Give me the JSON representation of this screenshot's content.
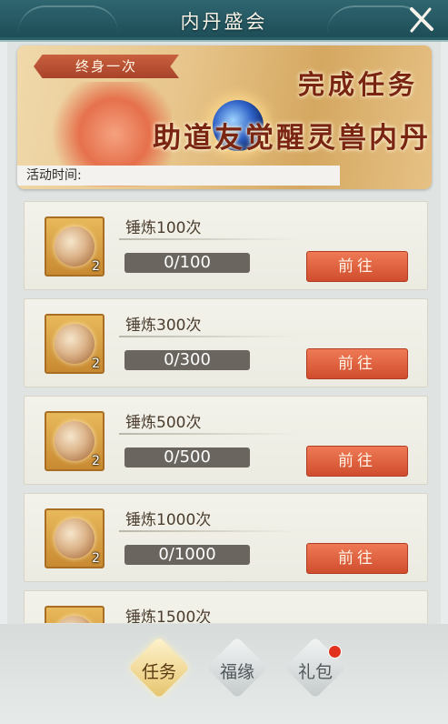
{
  "window": {
    "title": "内丹盛会"
  },
  "banner": {
    "badge": "终身一次",
    "headline": "完成任务",
    "subline": "助道友觉醒灵兽内丹",
    "time_label": "活动时间:"
  },
  "tasks": [
    {
      "name": "锤炼100次",
      "progress": "0/100",
      "reward_qty": "2",
      "button": "前往"
    },
    {
      "name": "锤炼300次",
      "progress": "0/300",
      "reward_qty": "2",
      "button": "前往"
    },
    {
      "name": "锤炼500次",
      "progress": "0/500",
      "reward_qty": "2",
      "button": "前往"
    },
    {
      "name": "锤炼1000次",
      "progress": "0/1000",
      "reward_qty": "2",
      "button": "前往"
    },
    {
      "name": "锤炼1500次",
      "progress": "",
      "reward_qty": "",
      "button": ""
    }
  ],
  "tabs": [
    {
      "label": "任务",
      "active": true
    },
    {
      "label": "福缘",
      "active": false
    },
    {
      "label": "礼包",
      "active": false,
      "notification": true
    }
  ],
  "colors": {
    "title_bar": "#1d4c56",
    "go_button": "#d04d2e",
    "progress_bg": "#6a665f",
    "notification": "#e1321f"
  }
}
